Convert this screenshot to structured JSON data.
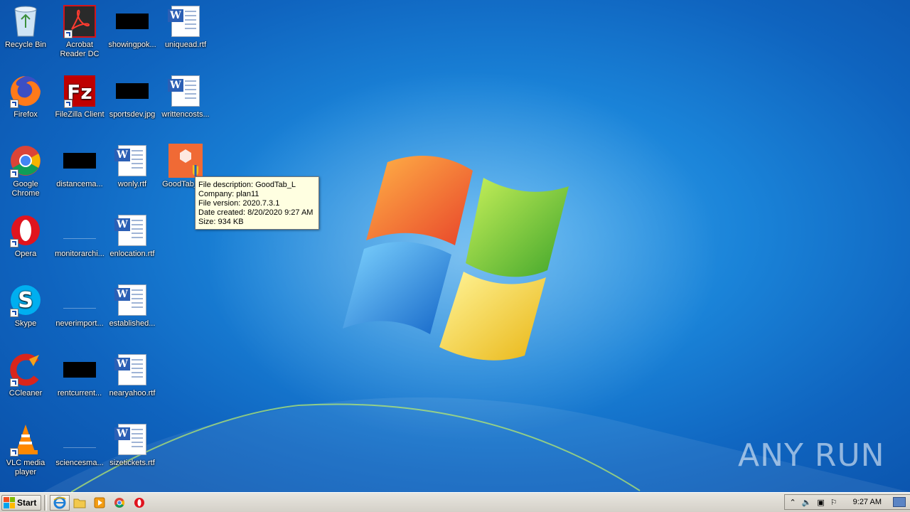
{
  "desktop": {
    "icons": [
      {
        "label": "Recycle Bin"
      },
      {
        "label": "Acrobat Reader DC"
      },
      {
        "label": "showingpok..."
      },
      {
        "label": "uniquead.rtf"
      },
      {
        "label": "Firefox"
      },
      {
        "label": "FileZilla Client"
      },
      {
        "label": "sportsdev.jpg"
      },
      {
        "label": "writtencosts..."
      },
      {
        "label": "Google Chrome"
      },
      {
        "label": "distancema..."
      },
      {
        "label": "wonly.rtf"
      },
      {
        "label": "GoodTab_L e"
      },
      {
        "label": "Opera"
      },
      {
        "label": "monitorarchi..."
      },
      {
        "label": "enlocation.rtf"
      },
      {
        "label": "Skype"
      },
      {
        "label": "neverimport..."
      },
      {
        "label": "established..."
      },
      {
        "label": "CCleaner"
      },
      {
        "label": "rentcurrent..."
      },
      {
        "label": "nearyahoo.rtf"
      },
      {
        "label": "VLC media player"
      },
      {
        "label": "sciencesma..."
      },
      {
        "label": "sizetickets.rtf"
      }
    ]
  },
  "tooltip": {
    "description": "File description: GoodTab_L",
    "company": "Company: plan11",
    "version": "File version: 2020.7.3.1",
    "created": "Date created: 8/20/2020 9:27 AM",
    "size": "Size: 934 KB"
  },
  "watermark": {
    "text": "ANY RUN"
  },
  "taskbar": {
    "start_label": "Start",
    "clock": "9:27 AM"
  },
  "colors": {
    "tooltip_bg": "#ffffe1",
    "taskbar_bg": "#d4d0c8",
    "desktop_blue": "#1a83d8"
  }
}
